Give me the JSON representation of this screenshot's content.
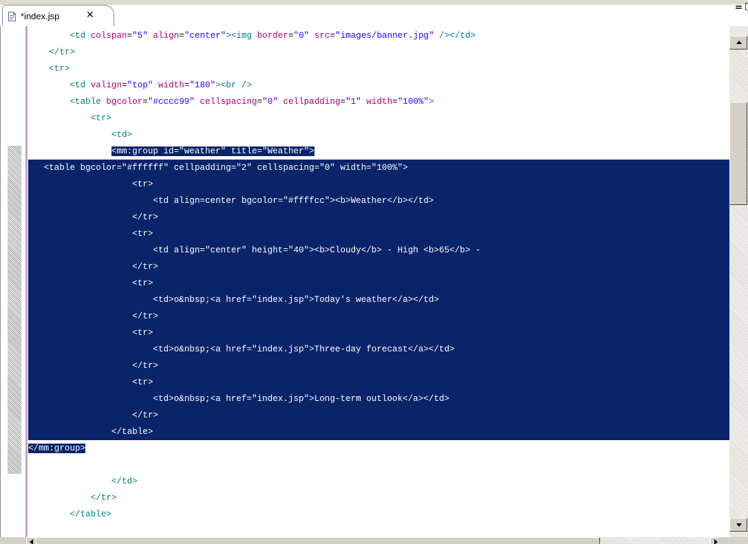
{
  "editor_tab": {
    "title": "*index.jsp",
    "close_glyph": "✕",
    "icon": "jsp-file-icon"
  },
  "colors": {
    "selection": "#0a246a",
    "tag": "#007c7c",
    "attribute": "#a8007c",
    "value": "#2a00ff",
    "change_bar": "#c7a2c9"
  },
  "code_lines": [
    {
      "indent": 8,
      "sel": "none",
      "tokens": [
        {
          "t": "tag",
          "s": "<td "
        },
        {
          "t": "attr",
          "s": "colspan"
        },
        {
          "t": "plain",
          "s": "="
        },
        {
          "t": "val",
          "s": "\"5\""
        },
        {
          "t": "plain",
          "s": " "
        },
        {
          "t": "attr",
          "s": "align"
        },
        {
          "t": "plain",
          "s": "="
        },
        {
          "t": "val",
          "s": "\"center\""
        },
        {
          "t": "tag",
          "s": "><img "
        },
        {
          "t": "attr",
          "s": "border"
        },
        {
          "t": "plain",
          "s": "="
        },
        {
          "t": "val",
          "s": "\"0\""
        },
        {
          "t": "plain",
          "s": " "
        },
        {
          "t": "attr",
          "s": "src"
        },
        {
          "t": "plain",
          "s": "="
        },
        {
          "t": "val",
          "s": "\"images/banner.jpg\""
        },
        {
          "t": "tag",
          "s": " /></td>"
        }
      ]
    },
    {
      "indent": 4,
      "sel": "none",
      "tokens": [
        {
          "t": "tag",
          "s": "</tr>"
        }
      ]
    },
    {
      "indent": 4,
      "sel": "none",
      "tokens": [
        {
          "t": "tag",
          "s": "<tr>"
        }
      ]
    },
    {
      "indent": 8,
      "sel": "none",
      "tokens": [
        {
          "t": "tag",
          "s": "<td "
        },
        {
          "t": "attr",
          "s": "valign"
        },
        {
          "t": "plain",
          "s": "="
        },
        {
          "t": "val",
          "s": "\"top\""
        },
        {
          "t": "plain",
          "s": " "
        },
        {
          "t": "attr",
          "s": "width"
        },
        {
          "t": "plain",
          "s": "="
        },
        {
          "t": "val",
          "s": "\"180\""
        },
        {
          "t": "tag",
          "s": "><br />"
        }
      ]
    },
    {
      "indent": 8,
      "sel": "none",
      "tokens": [
        {
          "t": "tag",
          "s": "<table "
        },
        {
          "t": "attr",
          "s": "bgcolor"
        },
        {
          "t": "plain",
          "s": "="
        },
        {
          "t": "val",
          "s": "\"#cccc99\""
        },
        {
          "t": "plain",
          "s": " "
        },
        {
          "t": "attr",
          "s": "cellspacing"
        },
        {
          "t": "plain",
          "s": "="
        },
        {
          "t": "val",
          "s": "\"0\""
        },
        {
          "t": "plain",
          "s": " "
        },
        {
          "t": "attr",
          "s": "cellpadding"
        },
        {
          "t": "plain",
          "s": "="
        },
        {
          "t": "val",
          "s": "\"1\""
        },
        {
          "t": "plain",
          "s": " "
        },
        {
          "t": "attr",
          "s": "width"
        },
        {
          "t": "plain",
          "s": "="
        },
        {
          "t": "val",
          "s": "\"100%\""
        },
        {
          "t": "tag",
          "s": ">"
        }
      ]
    },
    {
      "indent": 12,
      "sel": "none",
      "tokens": [
        {
          "t": "tag",
          "s": "<tr>"
        }
      ]
    },
    {
      "indent": 16,
      "sel": "none",
      "tokens": [
        {
          "t": "tag",
          "s": "<td>"
        }
      ]
    },
    {
      "indent": 16,
      "sel": "from-indent",
      "tokens": [
        {
          "t": "plain",
          "s": "<mm:group id=\"weather\" title=\"Weather\">"
        }
      ]
    },
    {
      "indent": 3,
      "sel": "full",
      "tokens": [
        {
          "t": "plain",
          "s": "<table bgcolor=\"#ffffff\" cellpadding=\"2\" cellspacing=\"0\" width=\"100%\">"
        }
      ]
    },
    {
      "indent": 20,
      "sel": "full",
      "tokens": [
        {
          "t": "plain",
          "s": "<tr>"
        }
      ]
    },
    {
      "indent": 24,
      "sel": "full",
      "tokens": [
        {
          "t": "plain",
          "s": "<td align=center bgcolor=\"#ffffcc\"><b>Weather</b></td>"
        }
      ]
    },
    {
      "indent": 20,
      "sel": "full",
      "tokens": [
        {
          "t": "plain",
          "s": "</tr>"
        }
      ]
    },
    {
      "indent": 20,
      "sel": "full",
      "tokens": [
        {
          "t": "plain",
          "s": "<tr>"
        }
      ]
    },
    {
      "indent": 24,
      "sel": "full",
      "tokens": [
        {
          "t": "plain",
          "s": "<td align=\"center\" height=\"40\"><b>Cloudy</b> - High <b>65</b> -"
        }
      ]
    },
    {
      "indent": 20,
      "sel": "full",
      "tokens": [
        {
          "t": "plain",
          "s": "</tr>"
        }
      ]
    },
    {
      "indent": 20,
      "sel": "full",
      "tokens": [
        {
          "t": "plain",
          "s": "<tr>"
        }
      ]
    },
    {
      "indent": 24,
      "sel": "full",
      "tokens": [
        {
          "t": "plain",
          "s": "<td>o&nbsp;<a href=\"index.jsp\">Today's weather</a></td>"
        }
      ]
    },
    {
      "indent": 20,
      "sel": "full",
      "tokens": [
        {
          "t": "plain",
          "s": "</tr>"
        }
      ]
    },
    {
      "indent": 20,
      "sel": "full",
      "tokens": [
        {
          "t": "plain",
          "s": "<tr>"
        }
      ]
    },
    {
      "indent": 24,
      "sel": "full",
      "tokens": [
        {
          "t": "plain",
          "s": "<td>o&nbsp;<a href=\"index.jsp\">Three-day forecast</a></td>"
        }
      ]
    },
    {
      "indent": 20,
      "sel": "full",
      "tokens": [
        {
          "t": "plain",
          "s": "</tr>"
        }
      ]
    },
    {
      "indent": 20,
      "sel": "full",
      "tokens": [
        {
          "t": "plain",
          "s": "<tr>"
        }
      ]
    },
    {
      "indent": 24,
      "sel": "full",
      "tokens": [
        {
          "t": "plain",
          "s": "<td>o&nbsp;<a href=\"index.jsp\">Long-term outlook</a></td>"
        }
      ]
    },
    {
      "indent": 20,
      "sel": "full",
      "tokens": [
        {
          "t": "plain",
          "s": "</tr>"
        }
      ]
    },
    {
      "indent": 16,
      "sel": "full",
      "tokens": [
        {
          "t": "plain",
          "s": "</table>"
        }
      ]
    },
    {
      "indent": 0,
      "sel": "text-only",
      "tokens": [
        {
          "t": "plain",
          "s": "</mm:group>"
        }
      ]
    },
    {
      "indent": 0,
      "sel": "none",
      "tokens": []
    },
    {
      "indent": 16,
      "sel": "none",
      "tokens": [
        {
          "t": "tag",
          "s": "</td>"
        }
      ]
    },
    {
      "indent": 12,
      "sel": "none",
      "tokens": [
        {
          "t": "tag",
          "s": "</tr>"
        }
      ]
    },
    {
      "indent": 8,
      "sel": "none",
      "tokens": [
        {
          "t": "tag",
          "s": "</table>"
        }
      ]
    }
  ]
}
